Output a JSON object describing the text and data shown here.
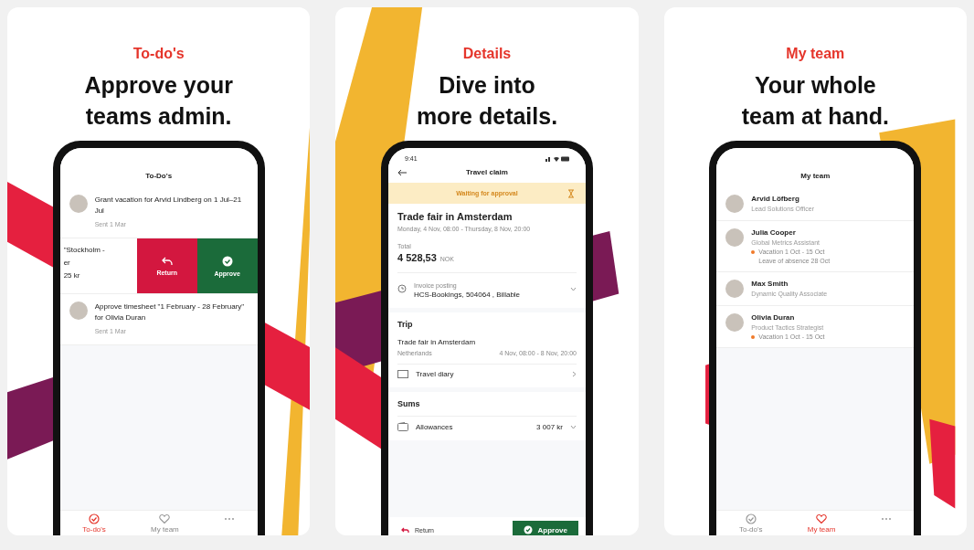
{
  "panels": [
    {
      "kind": "todos",
      "heading": "To-do's",
      "title_lines": [
        "Approve your",
        "teams admin."
      ],
      "screen": {
        "header": "To-Do's",
        "items": [
          {
            "kind": "task",
            "text": "Grant vacation for Arvid Lindberg on 1 Jul–21 Jul",
            "meta": "Sent 1 Mar"
          },
          {
            "kind": "swiped",
            "lines": [
              "\"Stockholm -",
              "er",
              "25 kr"
            ],
            "actions": [
              {
                "kind": "return",
                "label": "Return"
              },
              {
                "kind": "approve",
                "label": "Approve"
              }
            ]
          },
          {
            "kind": "task",
            "text": "Approve timesheet \"1 February - 28 February\" for Olivia Duran",
            "meta": "Sent 1 Mar"
          }
        ],
        "tabs": [
          {
            "kind": "todo",
            "label": "To-do's",
            "selected": true
          },
          {
            "kind": "team",
            "label": "My team",
            "selected": false
          },
          {
            "kind": "more",
            "selected": false
          }
        ]
      }
    },
    {
      "kind": "details",
      "heading": "Details",
      "title_lines": [
        "Dive into",
        "more details."
      ],
      "screen": {
        "time": "9:41",
        "header": "Travel claim",
        "banner": "Waiting for approval",
        "claim_title": "Trade fair in Amsterdam",
        "claim_dates": "Monday, 4 Nov, 08:00 - Thursday, 8 Nov, 20:00",
        "total_label": "Total",
        "total_amount": "4 528,53",
        "total_currency": "NOK",
        "posting": {
          "label": "Invoice posting",
          "value": "HCS-Bookings, 504064 , Billable"
        },
        "sections": [
          {
            "title": "Trip",
            "trip": {
              "name": "Trade fair in Amsterdam",
              "country": "Netherlands",
              "dates": "4 Nov, 08:00 - 8 Nov, 20:00"
            },
            "row": {
              "kind": "diary",
              "label": "Travel diary"
            }
          },
          {
            "title": "Sums",
            "row": {
              "kind": "allowance",
              "label": "Allowances",
              "amount": "3 007 kr"
            }
          }
        ],
        "return_label": "Return",
        "approve_label": "Approve"
      }
    },
    {
      "kind": "team",
      "heading": "My team",
      "title_lines": [
        "Your whole",
        "team at hand."
      ],
      "screen": {
        "header": "My team",
        "members": [
          {
            "name": "Arvid Löfberg",
            "role": "Lead Solutions Officer"
          },
          {
            "name": "Julia Cooper",
            "role": "Global Metrics Assistant",
            "absences": [
              {
                "text": "Vacation 1 Oct - 15 Oct",
                "dot": true
              },
              {
                "text": "Leave of absence 28 Oct",
                "dot": false
              }
            ]
          },
          {
            "name": "Max Smith",
            "role": "Dynamic Quality Associate"
          },
          {
            "name": "Olivia Duran",
            "role": "Product Tactics Strategist",
            "absences": [
              {
                "text": "Vacation 1 Oct - 15 Oct",
                "dot": true
              }
            ]
          }
        ],
        "tabs": [
          {
            "kind": "todo",
            "label": "To-do's",
            "selected": false
          },
          {
            "kind": "team",
            "label": "My team",
            "selected": true
          },
          {
            "kind": "more",
            "selected": false
          }
        ]
      }
    }
  ]
}
